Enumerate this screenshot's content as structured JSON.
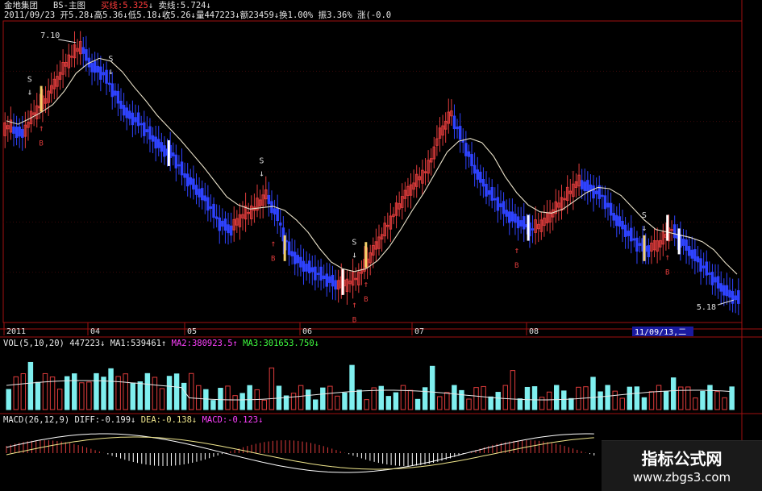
{
  "header": {
    "stock_name": "金地集团",
    "chart_name": "BS-主图",
    "buy_line_label": "买线:",
    "buy_line_value": "5.325",
    "sell_line_label": "卖线:",
    "sell_line_value": "5.724",
    "quote_line": "2011/09/23 开5.28↓高5.36↓低5.18↓收5.26↓量447223↓额23459↓换1.00% 振3.36% 涨(-0.0"
  },
  "price_panel": {
    "high_label": "7.10",
    "low_label": "5.18",
    "signal_sell": "S",
    "signal_buy": "B",
    "x_axis_labels": [
      "2011",
      "04",
      "05",
      "06",
      "07",
      "08"
    ],
    "cursor_date": "11/09/13,二"
  },
  "volume_panel": {
    "header_prefix": "VOL(5,10,20)",
    "vol": "447223↓",
    "ma1": "MA1:539461↑",
    "ma2": "MA2:380923.5↑",
    "ma3": "MA3:301653.750↓"
  },
  "macd_panel": {
    "header_prefix": "MACD(26,12,9)",
    "diff": "DIFF:-0.199↓",
    "dea": "DEA:-0.138↓",
    "macd": "MACD:-0.123↓"
  },
  "watermark": {
    "title": "指标公式网",
    "url": "www.zbgs3.com"
  },
  "colors": {
    "background": "#000000",
    "up_candle": "#e03c3c",
    "down_candle": "#2f43ff",
    "signal_bar": "#f3d06a",
    "signal_bar_white": "#ffffff",
    "ma_line": "#e8e0c8",
    "volume_up": "#e03c3c",
    "volume_down": "#7fefef",
    "grid": "#a01010",
    "macd_diff": "#ffffff",
    "macd_dea": "#f0e68c",
    "ma2_text": "#ff40ff",
    "ma3_text": "#40ff40"
  },
  "chart_data": [
    {
      "type": "candlestick",
      "title": "金地集团 BS-主图",
      "ylim_approx": [
        5.18,
        7.1
      ],
      "x_labels": [
        "2011",
        "04",
        "05",
        "06",
        "07",
        "08"
      ],
      "annotated_high": 7.1,
      "annotated_low": 5.18,
      "last_bar": {
        "date": "2011/09/23",
        "open": 5.28,
        "high": 5.36,
        "low": 5.18,
        "close": 5.26,
        "volume": 447223,
        "amount": 23459,
        "turnover": "1.00%",
        "amplitude": "3.36%"
      },
      "buy_line": 5.325,
      "sell_line": 5.724,
      "close_path_approx": [
        6.45,
        6.4,
        6.55,
        6.65,
        6.8,
        6.95,
        7.05,
        6.9,
        6.85,
        6.7,
        6.55,
        6.5,
        6.4,
        6.3,
        6.25,
        6.1,
        6.0,
        5.9,
        5.75,
        5.7,
        5.8,
        5.85,
        5.95,
        5.8,
        5.55,
        5.45,
        5.4,
        5.35,
        5.3,
        5.3,
        5.35,
        5.5,
        5.65,
        5.8,
        5.95,
        6.05,
        6.15,
        6.4,
        6.55,
        6.35,
        6.15,
        6.0,
        5.9,
        5.8,
        5.75,
        5.7,
        5.75,
        5.85,
        5.95,
        6.05,
        6.0,
        5.95,
        5.8,
        5.7,
        5.6,
        5.55,
        5.6,
        5.7,
        5.6,
        5.5,
        5.4,
        5.3,
        5.22,
        5.18
      ]
    },
    {
      "type": "bar",
      "title": "VOL(5,10,20)",
      "series": [
        {
          "name": "MA1",
          "value": 539461
        },
        {
          "name": "MA2",
          "value": 380923.5
        },
        {
          "name": "MA3",
          "value": 301653.75
        }
      ],
      "last_volume": 447223
    },
    {
      "type": "line",
      "title": "MACD(26,12,9)",
      "series": [
        {
          "name": "DIFF",
          "value": -0.199
        },
        {
          "name": "DEA",
          "value": -0.138
        },
        {
          "name": "MACD",
          "value": -0.123
        }
      ]
    }
  ]
}
